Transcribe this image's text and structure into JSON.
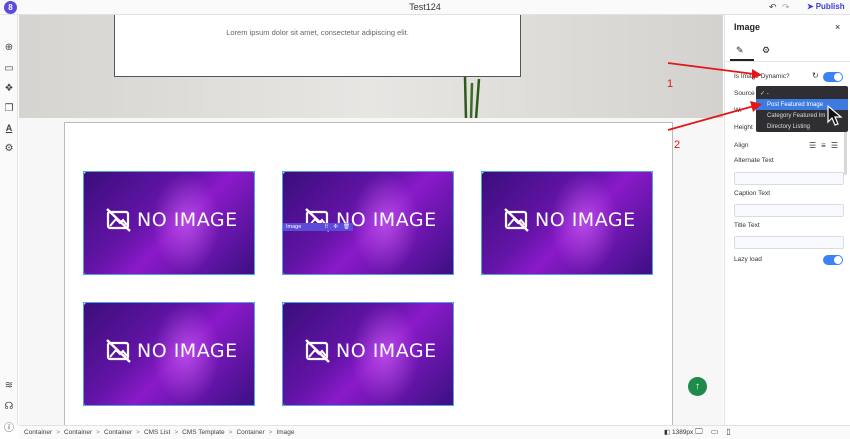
{
  "app": {
    "title": "Test124",
    "logo": "8",
    "publish_label": "Publish"
  },
  "hero": {
    "text": "Lorem ipsum dolor sit amet, consectetur adipiscing elit."
  },
  "card_label": "NO IMAGE",
  "image_tag": "Image",
  "breadcrumb": [
    "Container",
    "Container",
    "Container",
    "CMS List",
    "CMS Template",
    "Container",
    "Image"
  ],
  "breadcrumb_sep": ">",
  "zoom": "1389px",
  "panel": {
    "title": "Image",
    "close": "×",
    "is_dynamic_label": "Is Image Dynamic?",
    "source_label": "Source",
    "width_label": "Wi",
    "height_label": "Height",
    "align_label": "Align",
    "alt_label": "Alternate Text",
    "caption_label": "Caption Text",
    "title_text_label": "Title Text",
    "lazy_label": "Lazy load"
  },
  "dropdown": {
    "options": [
      "-",
      "Post Featured Image",
      "Category Featured Im",
      "Directory Listing"
    ],
    "selected": "Post Featured Image",
    "checked": "-"
  },
  "annotations": [
    "1",
    "2"
  ],
  "colors": {
    "accent": "#3b82f6",
    "brand": "#5b4bd8",
    "fab": "#1e8a4c",
    "annotation": "#e01818"
  }
}
